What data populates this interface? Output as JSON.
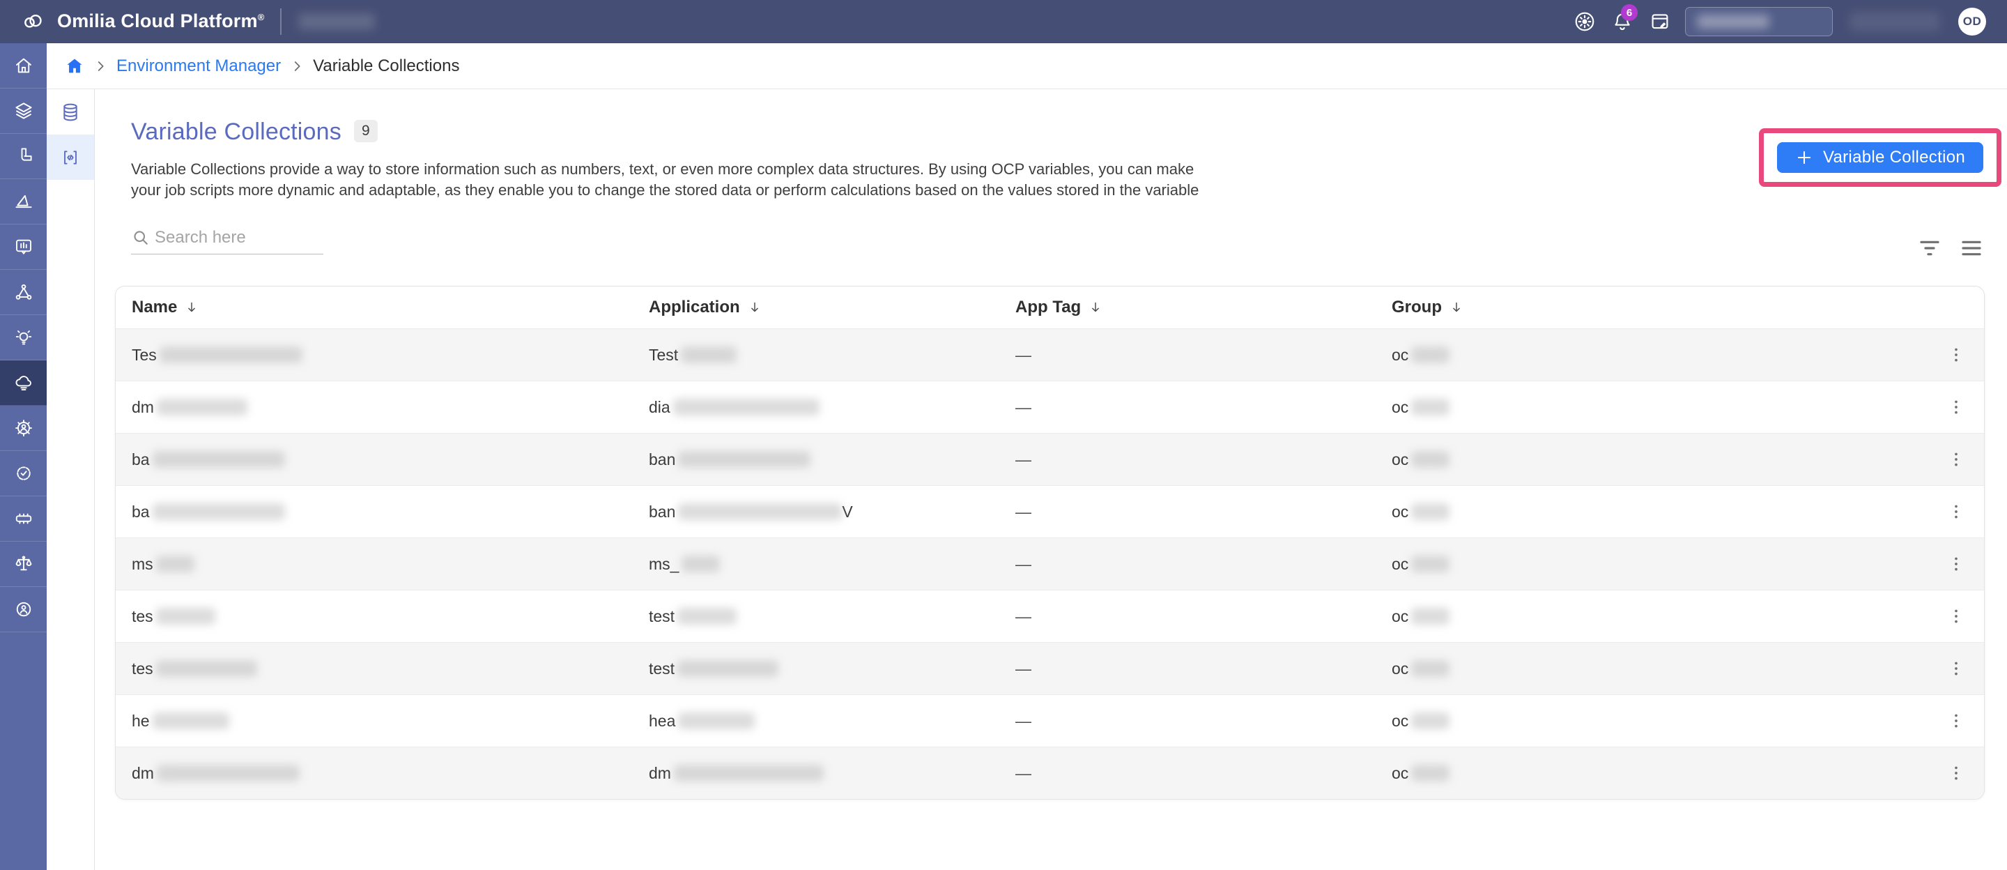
{
  "topbar": {
    "logo_text": "Omilia Cloud Platform",
    "logo_reg": "®",
    "notification_count": "6",
    "avatar_initials": "OD",
    "search_value_redacted": true
  },
  "breadcrumb": {
    "link_label": "Environment Manager",
    "current_label": "Variable Collections"
  },
  "sidebar": {
    "active_index": 7,
    "items": [
      {
        "icon": "home-icon"
      },
      {
        "icon": "layers-icon"
      },
      {
        "icon": "pipeline-icon"
      },
      {
        "icon": "design-ruler-icon"
      },
      {
        "icon": "chat-metrics-icon"
      },
      {
        "icon": "network-icon"
      },
      {
        "icon": "insights-bulb-icon"
      },
      {
        "icon": "cloud-environment-icon"
      },
      {
        "icon": "user-settings-gear-icon"
      },
      {
        "icon": "badge-check-icon"
      },
      {
        "icon": "chip-icon"
      },
      {
        "icon": "scales-icon"
      },
      {
        "icon": "support-icon"
      }
    ]
  },
  "subsidebar": {
    "active_index": 1,
    "items": [
      {
        "icon": "database-icon"
      },
      {
        "icon": "code-icon"
      }
    ]
  },
  "page": {
    "title": "Variable Collections",
    "count_badge": "9",
    "description_line1": "Variable Collections provide a way to store information such as numbers, text, or even more complex data structures. By using OCP variables, you can make",
    "description_line2": "your job scripts more dynamic and adaptable, as they enable you to change the stored data or perform calculations based on the values stored in the variable",
    "add_button_plus": "+",
    "add_button_label": "Variable Collection",
    "search_placeholder": "Search here"
  },
  "table": {
    "columns": [
      "Name",
      "Application",
      "App Tag",
      "Group"
    ],
    "rows": [
      {
        "name_prefix": "Tes",
        "name_redacted_width": 205,
        "application_prefix": "Test",
        "application_redacted_width": 80,
        "application_suffix": "",
        "app_tag": "—",
        "group_prefix": "oc",
        "group_redacted_width": 55
      },
      {
        "name_prefix": "dm",
        "name_redacted_width": 130,
        "application_prefix": "dia",
        "application_redacted_width": 210,
        "application_suffix": "",
        "app_tag": "—",
        "group_prefix": "oc",
        "group_redacted_width": 55
      },
      {
        "name_prefix": "ba",
        "name_redacted_width": 190,
        "application_prefix": "ban",
        "application_redacted_width": 190,
        "application_suffix": "",
        "app_tag": "—",
        "group_prefix": "oc",
        "group_redacted_width": 55
      },
      {
        "name_prefix": "ba",
        "name_redacted_width": 190,
        "application_prefix": "ban",
        "application_redacted_width": 235,
        "application_suffix": "V",
        "app_tag": "—",
        "group_prefix": "oc",
        "group_redacted_width": 55
      },
      {
        "name_prefix": "ms",
        "name_redacted_width": 55,
        "application_prefix": "ms_",
        "application_redacted_width": 55,
        "application_suffix": "",
        "app_tag": "—",
        "group_prefix": "oc",
        "group_redacted_width": 55
      },
      {
        "name_prefix": "tes",
        "name_redacted_width": 85,
        "application_prefix": "test",
        "application_redacted_width": 85,
        "application_suffix": "",
        "app_tag": "—",
        "group_prefix": "oc",
        "group_redacted_width": 55
      },
      {
        "name_prefix": "tes",
        "name_redacted_width": 145,
        "application_prefix": "test",
        "application_redacted_width": 145,
        "application_suffix": "",
        "app_tag": "—",
        "group_prefix": "oc",
        "group_redacted_width": 55
      },
      {
        "name_prefix": "he",
        "name_redacted_width": 110,
        "application_prefix": "hea",
        "application_redacted_width": 110,
        "application_suffix": "",
        "app_tag": "—",
        "group_prefix": "oc",
        "group_redacted_width": 55
      },
      {
        "name_prefix": "dm",
        "name_redacted_width": 205,
        "application_prefix": "dm",
        "application_redacted_width": 215,
        "application_suffix": "",
        "app_tag": "—",
        "group_prefix": "oc",
        "group_redacted_width": 55
      }
    ]
  },
  "colors": {
    "topbar_bg": "#454e74",
    "sidebar_bg": "#5a68a4",
    "sidebar_active_bg": "#343f69",
    "subrail_active_bg": "#e8effc",
    "accent_blue": "#2e7cf6",
    "link_blue": "#2979f2",
    "title_indigo": "#5a6abf",
    "highlight_pink": "#e8487c",
    "notification_badge_purple": "#b13ad1",
    "row_alt_gray": "#f5f5f5"
  }
}
